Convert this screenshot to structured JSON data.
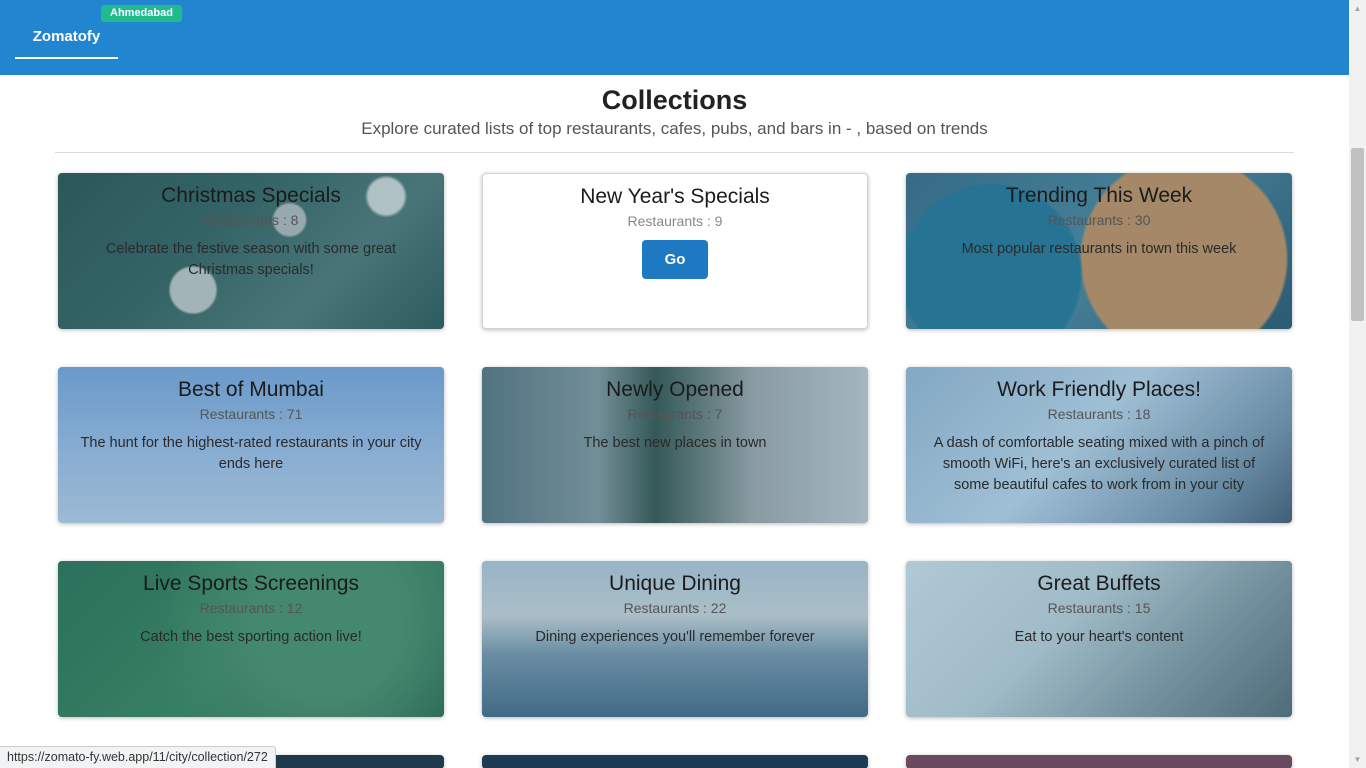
{
  "navbar": {
    "brand": "Zomatofy",
    "city": "Ahmedabad"
  },
  "header": {
    "title": "Collections",
    "subtitle": "Explore curated lists of top restaurants, cafes, pubs, and bars in - , based on trends"
  },
  "collections": [
    {
      "title": "Christmas Specials",
      "count": "Restaurants : 8",
      "description": "Celebrate the festive season with some great Christmas specials!"
    },
    {
      "title": "New Year's Specials",
      "count": "Restaurants : 9",
      "button": "Go"
    },
    {
      "title": "Trending This Week",
      "count": "Restaurants : 30",
      "description": "Most popular restaurants in town this week"
    },
    {
      "title": "Best of Mumbai",
      "count": "Restaurants : 71",
      "description": "The hunt for the highest-rated restaurants in your city ends here"
    },
    {
      "title": "Newly Opened",
      "count": "Restaurants : 7",
      "description": "The best new places in town"
    },
    {
      "title": "Work Friendly Places!",
      "count": "Restaurants : 18",
      "description": "A dash of comfortable seating mixed with a pinch of smooth WiFi, here's an exclusively curated list of some beautiful cafes to work from in your city"
    },
    {
      "title": "Live Sports Screenings",
      "count": "Restaurants : 12",
      "description": "Catch the best sporting action live!"
    },
    {
      "title": "Unique Dining",
      "count": "Restaurants : 22",
      "description": "Dining experiences you'll remember forever"
    },
    {
      "title": "Great Buffets",
      "count": "Restaurants : 15",
      "description": "Eat to your heart's content"
    }
  ],
  "status_url": "https://zomato-fy.web.app/11/city/collection/272"
}
